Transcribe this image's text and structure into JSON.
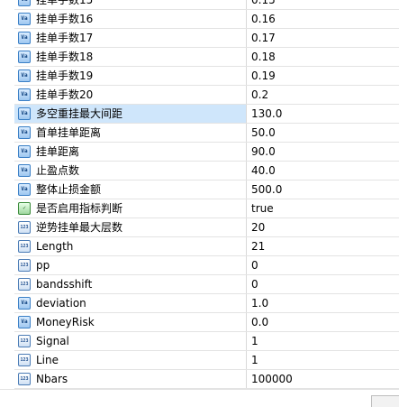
{
  "rows": [
    {
      "name": "挂单手数15",
      "value": "0.15",
      "type": "va"
    },
    {
      "name": "挂单手数16",
      "value": "0.16",
      "type": "va"
    },
    {
      "name": "挂单手数17",
      "value": "0.17",
      "type": "va"
    },
    {
      "name": "挂单手数18",
      "value": "0.18",
      "type": "va"
    },
    {
      "name": "挂单手数19",
      "value": "0.19",
      "type": "va"
    },
    {
      "name": "挂单手数20",
      "value": "0.2",
      "type": "va"
    },
    {
      "name": "多空重挂最大间距",
      "value": "130.0",
      "type": "va"
    },
    {
      "name": "首单挂单距离",
      "value": "50.0",
      "type": "va"
    },
    {
      "name": "挂单距离",
      "value": "90.0",
      "type": "va"
    },
    {
      "name": "止盈点数",
      "value": "40.0",
      "type": "va"
    },
    {
      "name": "整体止损金额",
      "value": "500.0",
      "type": "va"
    },
    {
      "name": "是否启用指标判断",
      "value": "true",
      "type": "bool"
    },
    {
      "name": "逆势挂单最大层数",
      "value": "20",
      "type": "num"
    },
    {
      "name": "Length",
      "value": "21",
      "type": "num"
    },
    {
      "name": "pp",
      "value": "0",
      "type": "num"
    },
    {
      "name": "bandsshift",
      "value": "0",
      "type": "num"
    },
    {
      "name": "deviation",
      "value": "1.0",
      "type": "va"
    },
    {
      "name": "MoneyRisk",
      "value": "0.0",
      "type": "va"
    },
    {
      "name": "Signal",
      "value": "1",
      "type": "num"
    },
    {
      "name": "Line",
      "value": "1",
      "type": "num"
    },
    {
      "name": "Nbars",
      "value": "100000",
      "type": "num"
    }
  ],
  "icons": {
    "va": "Va",
    "bool": "✓",
    "num": "123"
  }
}
